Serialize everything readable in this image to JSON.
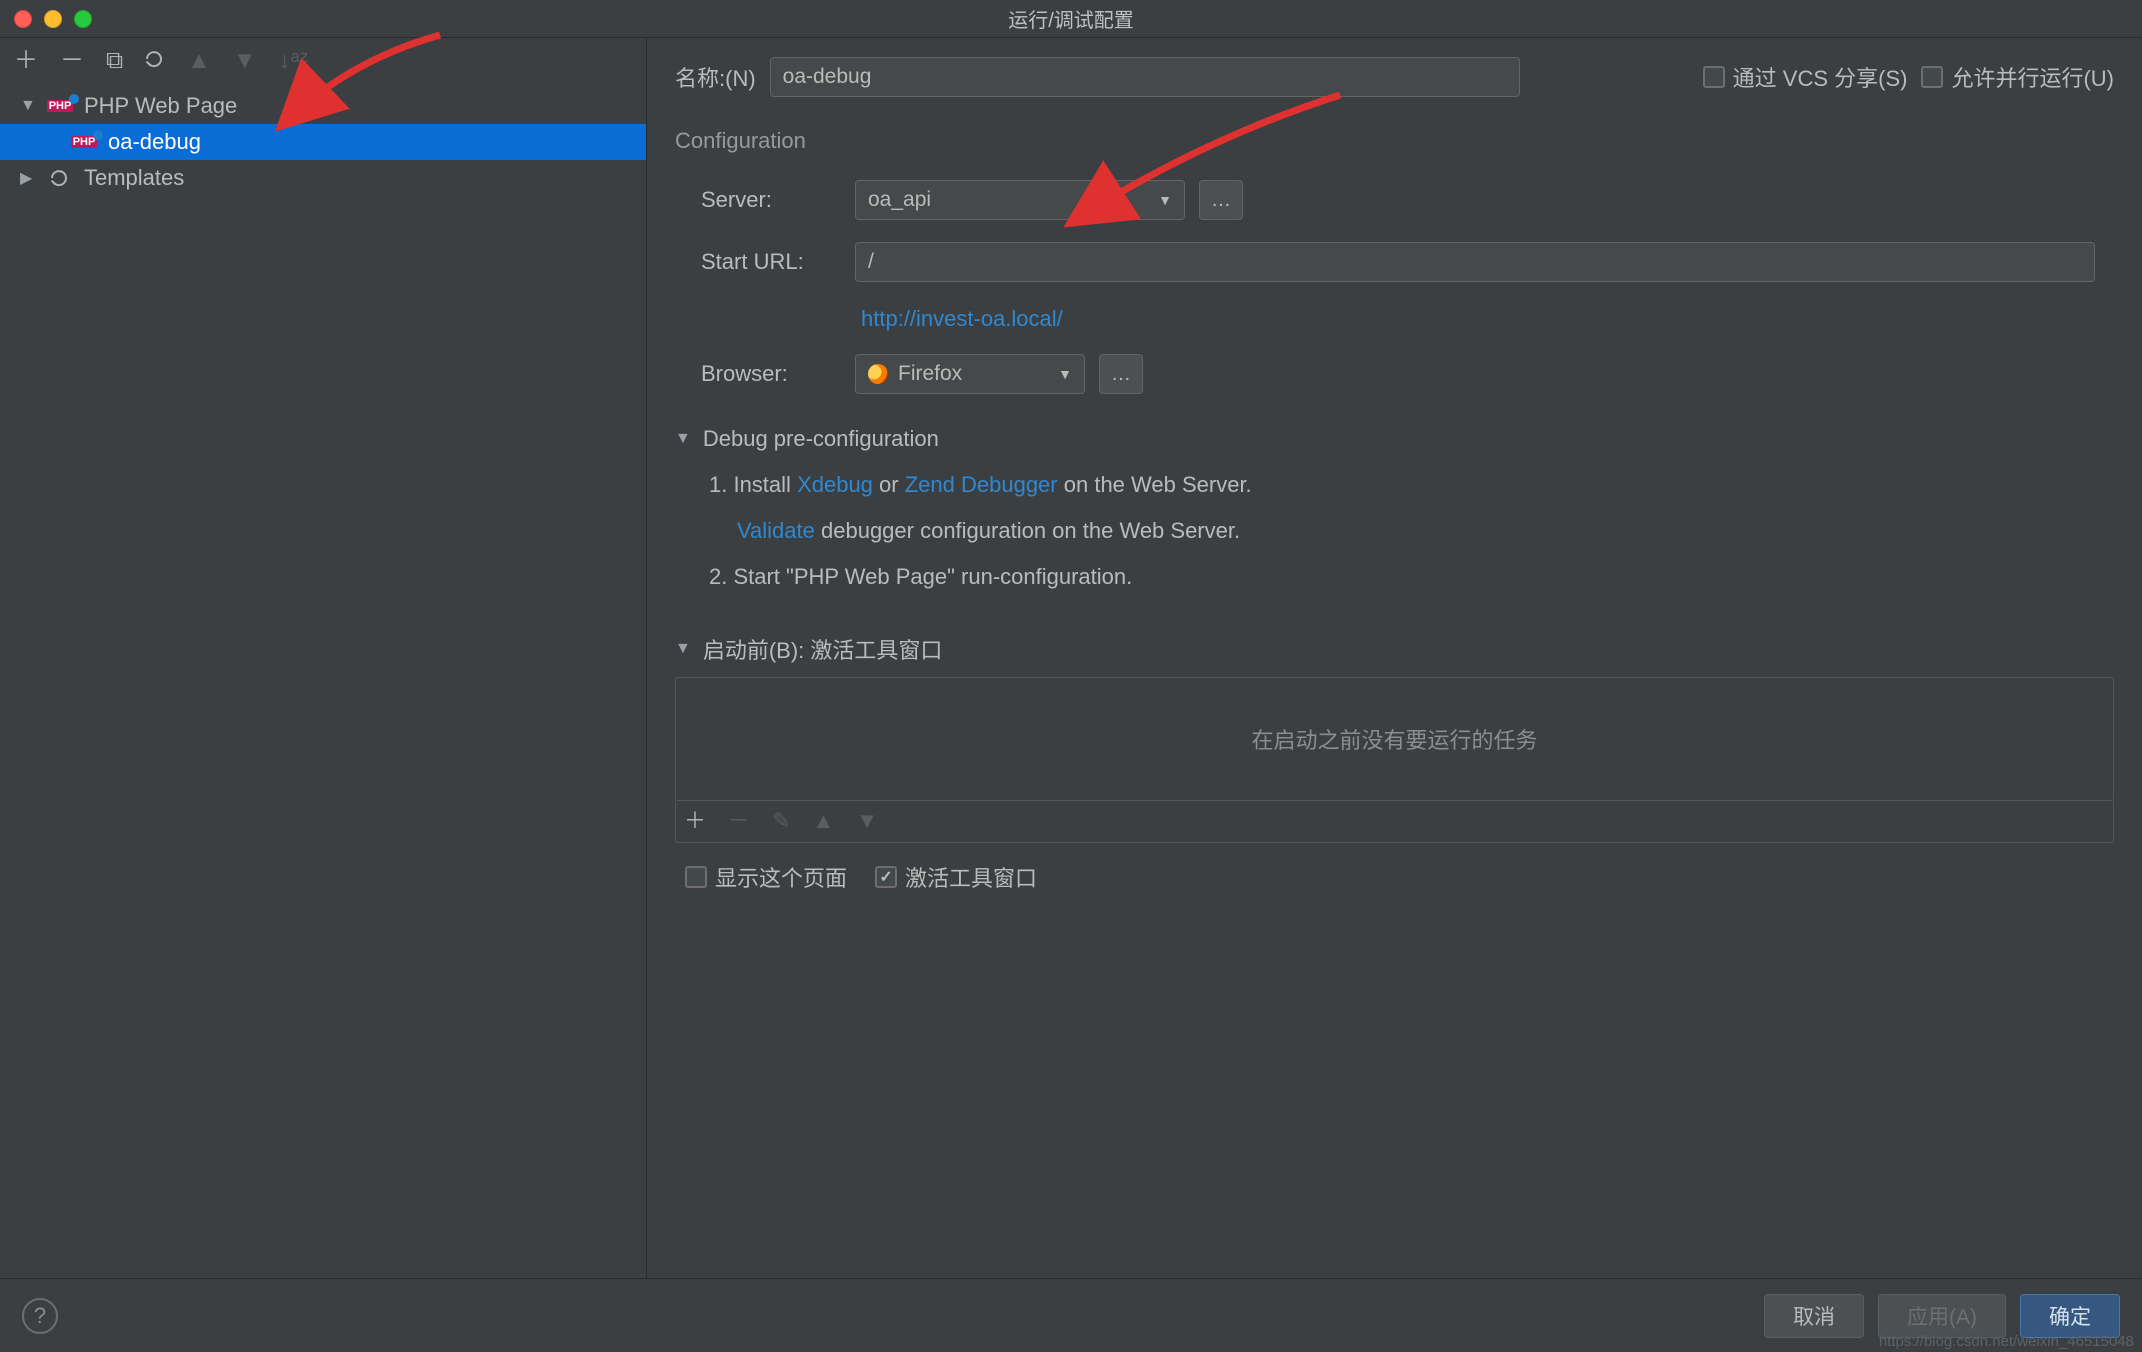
{
  "window_title": "运行/调试配置",
  "sidebar": {
    "category_php_web_page": "PHP Web Page",
    "item_oa_debug": "oa-debug",
    "category_templates": "Templates"
  },
  "header": {
    "name_label": "名称:(N)",
    "name_value": "oa-debug",
    "share_via_vcs_label": "通过 VCS 分享(S)",
    "allow_parallel_run_label": "允许并行运行(U)"
  },
  "config": {
    "section_title": "Configuration",
    "server_label": "Server:",
    "server_value": "oa_api",
    "start_url_label": "Start URL:",
    "start_url_value": "/",
    "url_preview": "http://invest-oa.local/",
    "browser_label": "Browser:",
    "browser_value": "Firefox"
  },
  "debug_pre": {
    "title": "Debug pre-configuration",
    "step1_prefix": "1. Install",
    "xdebug": "Xdebug",
    "or": "or",
    "zend_debugger": "Zend Debugger",
    "step1_suffix": "on the Web Server.",
    "validate": "Validate",
    "validate_suffix": "debugger configuration on the Web Server.",
    "step2": "2. Start \"PHP Web Page\" run-configuration."
  },
  "before_launch": {
    "title": "启动前(B): 激活工具窗口",
    "empty_text": "在启动之前没有要运行的任务",
    "show_page_label": "显示这个页面",
    "activate_tool_window_label": "激活工具窗口"
  },
  "footer": {
    "cancel": "取消",
    "apply": "应用(A)",
    "ok": "确定",
    "help": "?"
  },
  "watermark": "https://blog.csdn.net/weixin_46515048"
}
